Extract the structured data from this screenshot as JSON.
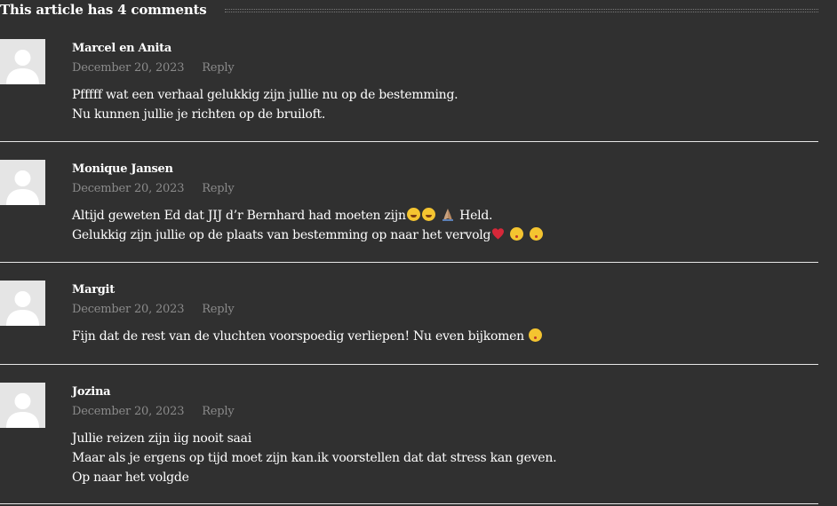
{
  "heading": "This article has 4 comments",
  "comments": [
    {
      "author": "Marcel en Anita",
      "date": "December 20, 2023",
      "reply": "Reply",
      "lines": [
        "Pfffff wat een verhaal gelukkig zijn jullie nu op de bestemming.",
        "Nu kunnen jullie je richten op de bruiloft."
      ]
    },
    {
      "author": "Monique Jansen",
      "date": "December 20, 2023",
      "reply": "Reply",
      "lines": [
        "Altijd geweten Ed dat JIJ d’r Bernhard had moeten zijn",
        "Held.",
        "Gelukkig zijn jullie op de plaats van bestemming op naar het vervolg"
      ]
    },
    {
      "author": "Margit",
      "date": "December 20, 2023",
      "reply": "Reply",
      "lines": [
        "Fijn dat de rest van de vluchten voorspoedig verliepen! Nu even bijkomen"
      ]
    },
    {
      "author": "Jozina",
      "date": "December 20, 2023",
      "reply": "Reply",
      "lines": [
        "Jullie reizen zijn iig nooit saai",
        "Maar als je ergens op tijd moet zijn kan.ik voorstellen dat dat stress kan geven.",
        "Op naar het volgde"
      ]
    }
  ],
  "icons": {
    "avatar": "default-avatar-icon",
    "laugh": "rolling-laughing-emoji",
    "pray": "folded-hands-emoji",
    "heart": "red-heart-emoji",
    "kiss": "face-blowing-kiss-emoji"
  },
  "colors": {
    "background": "#303030",
    "text": "#ffffff",
    "meta": "#8a8a8a",
    "divider": "#e6e6e6",
    "avatar_bg": "#e5e5e5"
  }
}
